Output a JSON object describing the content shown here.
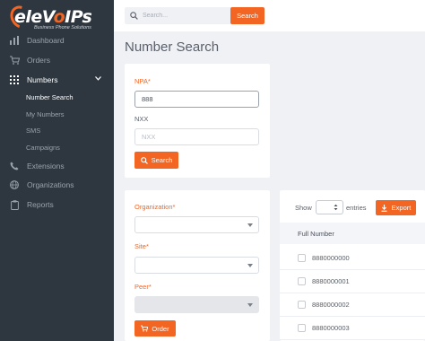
{
  "brand": {
    "name_prefix": "eleV",
    "name_o": "o",
    "name_suffix": "IPs",
    "tagline": "Business Phone Solutions",
    "accent": "#f26522",
    "sidebar_bg": "#2e3740"
  },
  "sidebar": {
    "items": [
      {
        "label": "Dashboard",
        "icon": "bar-chart-icon"
      },
      {
        "label": "Orders",
        "icon": "cart-icon"
      },
      {
        "label": "Numbers",
        "icon": "grid-icon",
        "expanded": true
      },
      {
        "label": "Extensions",
        "icon": "phone-icon"
      },
      {
        "label": "Organizations",
        "icon": "globe-icon"
      },
      {
        "label": "Reports",
        "icon": "clipboard-icon"
      }
    ],
    "numbers_sub": [
      {
        "label": "Number Search",
        "active": true
      },
      {
        "label": "My Numbers"
      },
      {
        "label": "SMS"
      },
      {
        "label": "Campaigns"
      }
    ]
  },
  "topbar": {
    "search_placeholder": "Search...",
    "search_button": "Search"
  },
  "page": {
    "title": "Number Search"
  },
  "npa_form": {
    "npa_label": "NPA",
    "npa_value": "888",
    "nxx_label": "NXX",
    "nxx_placeholder": "NXX",
    "search_button": "Search"
  },
  "order_form": {
    "organization_label": "Organization",
    "site_label": "Site",
    "peer_label": "Peer",
    "order_button": "Order"
  },
  "results": {
    "show_label": "Show",
    "entries_label": "entries",
    "export_button": "Export",
    "column_header": "Full Number",
    "rows": [
      "8880000000",
      "8880000001",
      "8880000002",
      "8880000003"
    ]
  }
}
